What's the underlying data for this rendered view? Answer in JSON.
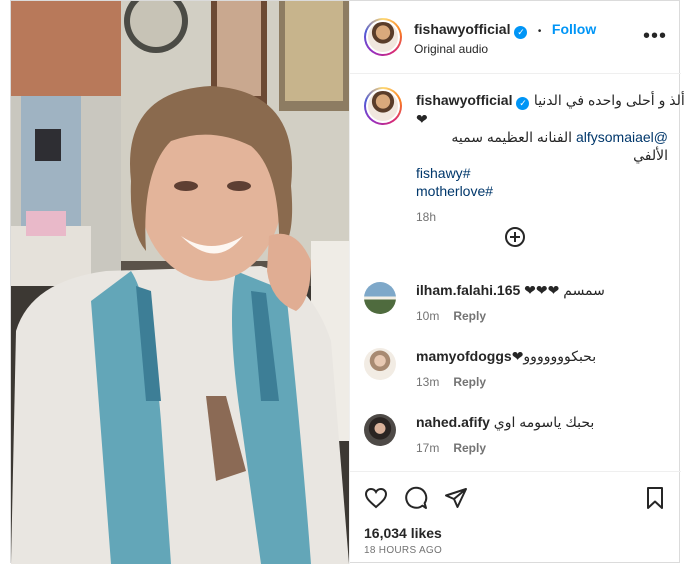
{
  "post": {
    "username": "fishawyofficial",
    "follow_label": "Follow",
    "dot": "•",
    "audio": "Original audio",
    "more": "•••"
  },
  "caption": {
    "username": "fishawyofficial",
    "line1": "ألذ و أحلى واحده في الدنيا",
    "heart": "❤",
    "line2_mention": "@alfysomaiael",
    "line2_text": "الفنانه العظيمه سميه الألفي",
    "tag1": "#fishawy",
    "tag2": "#motherlove",
    "time": "18h"
  },
  "comments": [
    {
      "username": "ilham.falahi.165",
      "text": "سمسم ❤❤❤",
      "time": "10m",
      "reply": "Reply"
    },
    {
      "username": "mamyofdoggs",
      "text": "بحبكووووووو❤",
      "time": "13m",
      "reply": "Reply"
    },
    {
      "username": "nahed.afify",
      "text": "بحبك ياسومه اوي",
      "time": "17m",
      "reply": "Reply"
    }
  ],
  "footer": {
    "likes": "16,034 likes",
    "posted": "18 HOURS AGO"
  },
  "icons": {
    "like": "heart-icon",
    "comment": "comment-icon",
    "share": "share-icon",
    "save": "bookmark-icon",
    "add": "add-circle-icon"
  },
  "colors": {
    "accent": "#0095f6",
    "link": "#00376b"
  }
}
